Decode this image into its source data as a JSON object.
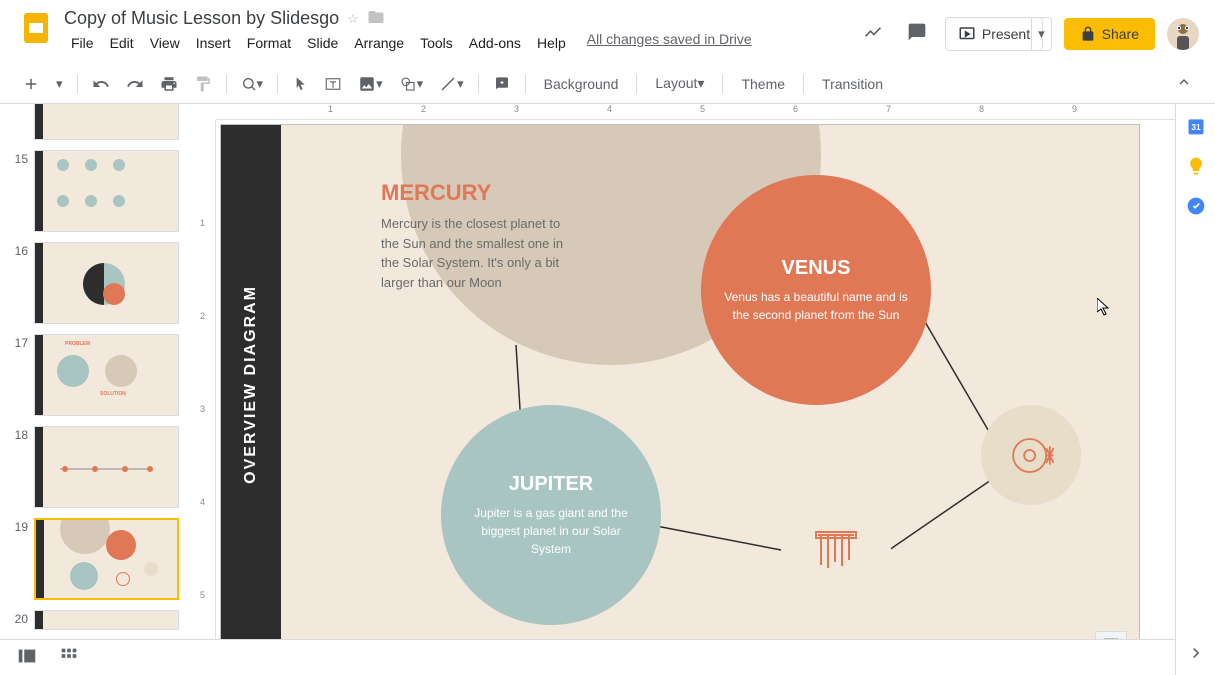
{
  "doc_title": "Copy of Music Lesson by Slidesgo",
  "save_status": "All changes saved in Drive",
  "menubar": [
    "File",
    "Edit",
    "View",
    "Insert",
    "Format",
    "Slide",
    "Arrange",
    "Tools",
    "Add-ons",
    "Help"
  ],
  "header_buttons": {
    "present": "Present",
    "share": "Share"
  },
  "toolbar": {
    "background": "Background",
    "layout": "Layout",
    "theme": "Theme",
    "transition": "Transition"
  },
  "thumbnails": [
    {
      "num": "15"
    },
    {
      "num": "16"
    },
    {
      "num": "17"
    },
    {
      "num": "18"
    },
    {
      "num": "19",
      "active": true
    },
    {
      "num": "20"
    }
  ],
  "slide": {
    "bar_title": "OVERVIEW DIAGRAM",
    "mercury": {
      "title": "MERCURY",
      "desc": "Mercury is the closest planet to the Sun and the smallest one in the Solar System. It's only a bit larger than our Moon"
    },
    "venus": {
      "title": "VENUS",
      "desc": "Venus has a beautiful name and is the second planet from the Sun"
    },
    "jupiter": {
      "title": "JUPITER",
      "desc": "Jupiter is a gas giant and the biggest planet in our Solar System"
    }
  },
  "ruler_marks": [
    "1",
    "2",
    "3",
    "4",
    "5",
    "6",
    "7",
    "8",
    "9"
  ],
  "ruler_v_marks": [
    "1",
    "2",
    "3",
    "4",
    "5"
  ]
}
